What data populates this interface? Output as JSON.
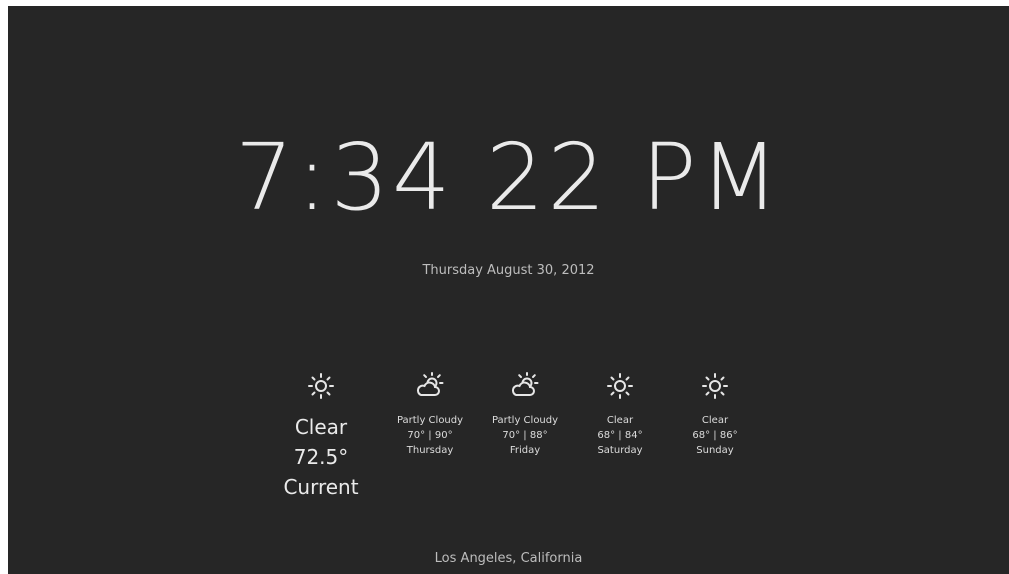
{
  "clock": {
    "time": "7:34 22 PM",
    "date": "Thursday August 30, 2012"
  },
  "current": {
    "icon": "sun-icon",
    "condition": "Clear",
    "temperature": "72.5°",
    "label": "Current"
  },
  "forecast": [
    {
      "icon": "partly-cloudy-icon",
      "condition": "Partly Cloudy",
      "temps": "70° | 90°",
      "day": "Thursday"
    },
    {
      "icon": "partly-cloudy-icon",
      "condition": "Partly Cloudy",
      "temps": "70° | 88°",
      "day": "Friday"
    },
    {
      "icon": "sun-icon",
      "condition": "Clear",
      "temps": "68° | 84°",
      "day": "Saturday"
    },
    {
      "icon": "sun-icon",
      "condition": "Clear",
      "temps": "68° | 86°",
      "day": "Sunday"
    }
  ],
  "location": "Los Angeles, California",
  "colors": {
    "background": "#262626",
    "text": "#e6e6e6",
    "muted_text": "#bdbdbd"
  }
}
